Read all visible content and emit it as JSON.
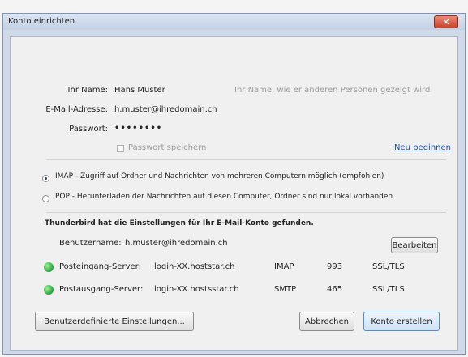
{
  "window": {
    "title": "Konto einrichten",
    "close_label": "✕"
  },
  "form": {
    "name_label": "Ihr Name:",
    "name_value": "Hans Muster",
    "name_hint": "Ihr Name, wie er anderen Personen gezeigt wird",
    "email_label": "E-Mail-Adresse:",
    "email_value": "h.muster@ihredomain.ch",
    "password_label": "Passwort:",
    "password_value": "••••••••",
    "save_password_label": "Passwort speichern",
    "restart_link": "Neu beginnen"
  },
  "protocol": {
    "imap_label": "IMAP - Zugriff auf Ordner und Nachrichten von mehreren Computern möglich   (empfohlen)",
    "pop_label": "POP - Herunterladen der Nachrichten auf diesen Computer, Ordner sind nur lokal vorhanden",
    "selected": "imap"
  },
  "found": {
    "heading": "Thunderbird hat die Einstellungen für Ihr E-Mail-Konto gefunden.",
    "username_label": "Benutzername:",
    "username_value": "h.muster@ihredomain.ch",
    "edit_button": "Bearbeiten",
    "servers": [
      {
        "label": "Posteingang-Server:",
        "host": "login-XX.hoststar.ch",
        "protocol": "IMAP",
        "port": "993",
        "security": "SSL/TLS",
        "status_color": "#27a33a"
      },
      {
        "label": "Postausgang-Server:",
        "host": "login-XX.hostsstar.ch",
        "protocol": "SMTP",
        "port": "465",
        "security": "SSL/TLS",
        "status_color": "#27a33a"
      }
    ]
  },
  "footer": {
    "advanced_button": "Benutzerdefinierte Einstellungen...",
    "cancel_button": "Abbrechen",
    "create_button": "Konto erstellen"
  }
}
